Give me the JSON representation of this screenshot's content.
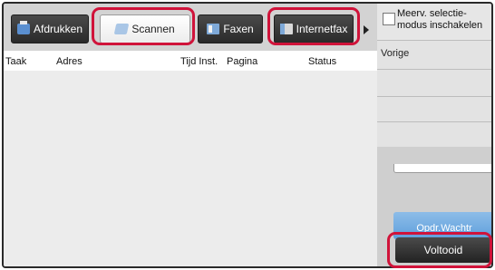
{
  "tabs": [
    {
      "label": "Afdrukken",
      "icon": "printer-icon"
    },
    {
      "label": "Scannen",
      "icon": "scanner-icon"
    },
    {
      "label": "Faxen",
      "icon": "fax-icon"
    },
    {
      "label": "Internetfax",
      "icon": "internet-fax-icon"
    }
  ],
  "columns": {
    "task": "Taak",
    "address": "Adres",
    "time": "Tijd Inst.",
    "page": "Pagina",
    "status": "Status"
  },
  "right_panel": {
    "multi_select_label": "Meerv. selectie-modus inschakelen",
    "previous_label": "Vorige",
    "queue_label": "Opdr.Wachtr",
    "done_label": "Voltooid"
  },
  "colors": {
    "highlight": "#d0133a",
    "accent_blue": "#5e9fdc"
  }
}
